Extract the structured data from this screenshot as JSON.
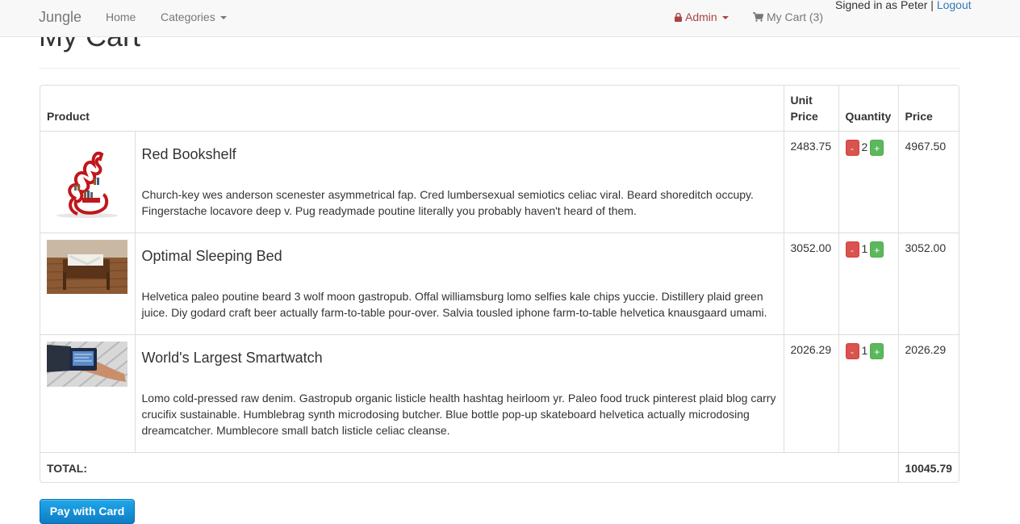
{
  "nav": {
    "brand": "Jungle",
    "home": "Home",
    "categories": "Categories",
    "admin": "Admin",
    "cart": "My Cart (3)",
    "signed_in": "Signed in as Peter",
    "separator": "|",
    "logout": "Logout"
  },
  "page": {
    "title": "My Cart"
  },
  "table": {
    "headers": {
      "product": "Product",
      "unit_price": "Unit Price",
      "quantity": "Quantity",
      "price": "Price"
    },
    "rows": [
      {
        "name": "Red Bookshelf",
        "description": "Church-key wes anderson scenester asymmetrical fap. Cred lumbersexual semiotics celiac viral. Beard shoreditch occupy. Fingerstache locavore deep v. Pug readymade poutine literally you probably haven't heard of them.",
        "unit_price": "2483.75",
        "quantity": "2",
        "price": "4967.50"
      },
      {
        "name": "Optimal Sleeping Bed",
        "description": "Helvetica paleo poutine beard 3 wolf moon gastropub. Offal williamsburg lomo selfies kale chips yuccie. Distillery plaid green juice. Diy godard craft beer actually farm-to-table pour-over. Salvia tousled iphone farm-to-table helvetica knausgaard umami.",
        "unit_price": "3052.00",
        "quantity": "1",
        "price": "3052.00"
      },
      {
        "name": "World's Largest Smartwatch",
        "description": "Lomo cold-pressed raw denim. Gastropub organic listicle health hashtag heirloom yr. Paleo food truck pinterest plaid blog carry crucifix sustainable. Humblebrag synth microdosing butcher. Blue bottle pop-up skateboard helvetica actually microdosing dreamcatcher. Mumblecore small batch listicle celiac cleanse.",
        "unit_price": "2026.29",
        "quantity": "1",
        "price": "2026.29"
      }
    ],
    "minus_label": "-",
    "plus_label": "+",
    "total_label": "TOTAL:",
    "total_value": "10045.79"
  },
  "pay_button": "Pay with Card",
  "colors": {
    "admin": "#a94442",
    "link": "#337ab7",
    "minus": "#d9534f",
    "plus": "#5cb85c",
    "pay": "#1a94dc"
  },
  "icons": [
    "lock-icon",
    "shopping-cart-icon",
    "caret-down-icon",
    "product-image"
  ]
}
